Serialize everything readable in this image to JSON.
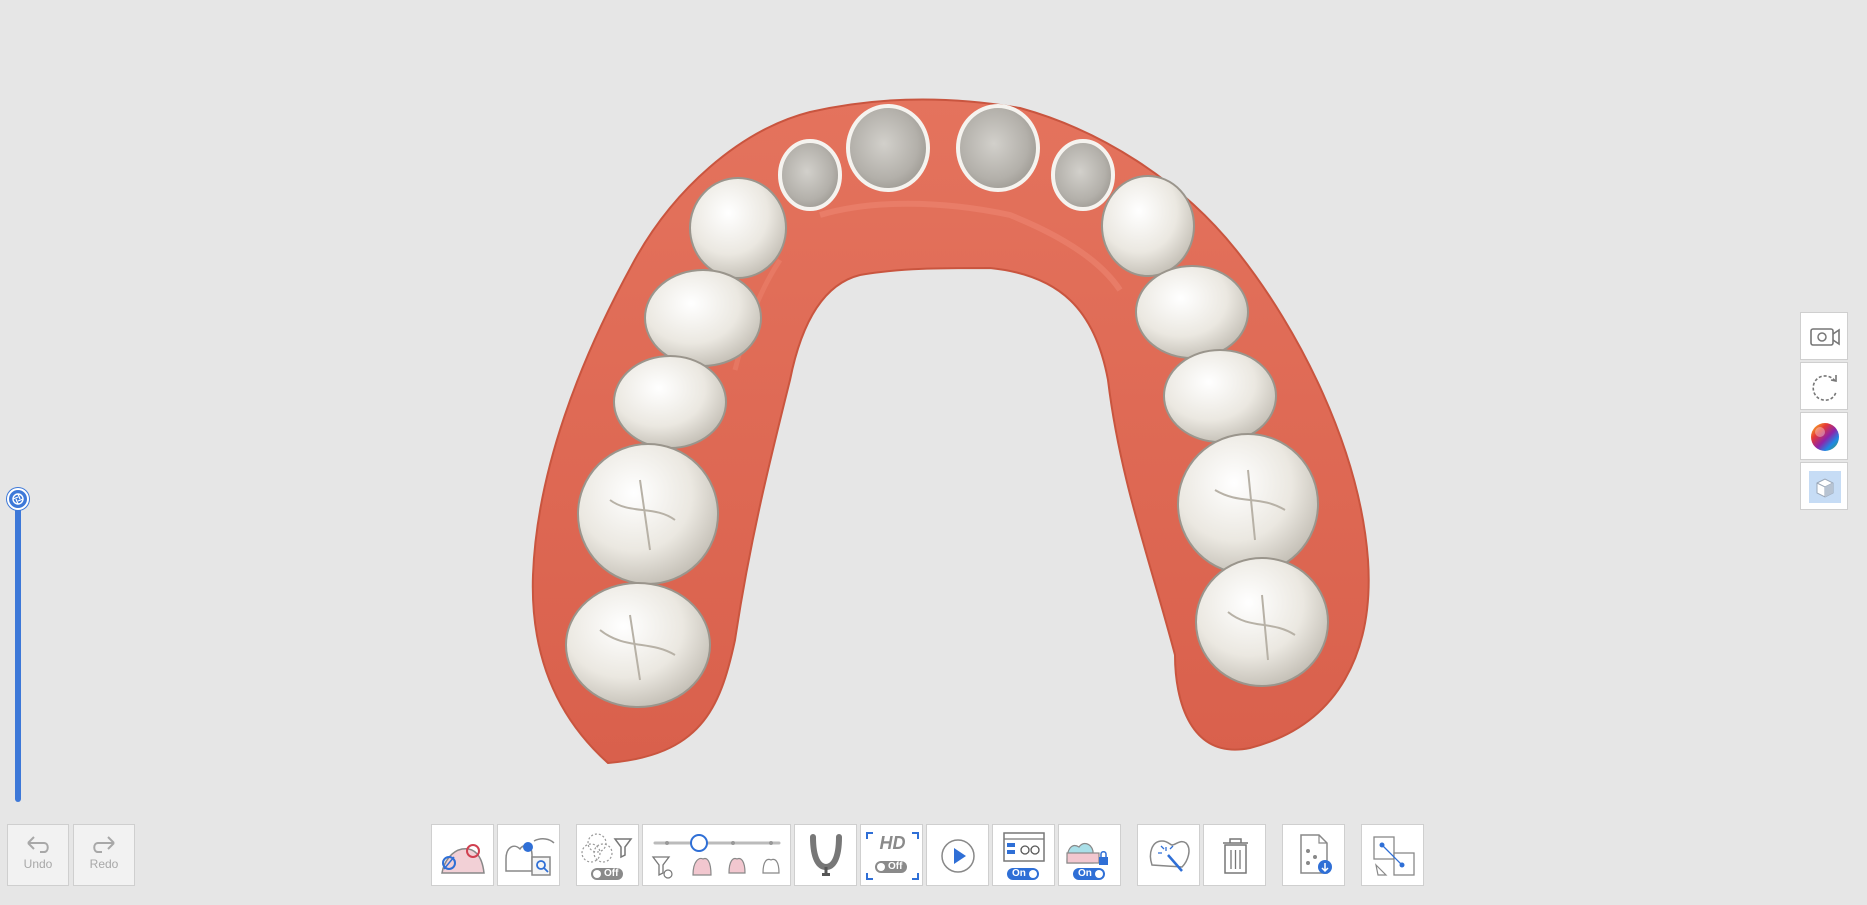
{
  "history": {
    "undo_label": "Undo",
    "redo_label": "Redo"
  },
  "toolbar": {
    "noise_filter_state": "Off",
    "hd_label": "HD",
    "hd_state": "Off",
    "ai_scan_state": "On",
    "lock_state": "On"
  },
  "slider": {
    "brightness_level": 1.0
  },
  "colors": {
    "accent": "#2f6fd6",
    "background": "#e6e6e6",
    "gum": "#e06b56",
    "tooth": "#ece9e2"
  },
  "icons": {
    "undo": "undo-arrow-icon",
    "redo": "redo-arrow-icon",
    "side": [
      "video-camera-icon",
      "rotate-icon",
      "color-map-icon",
      "solid-cube-icon"
    ]
  }
}
